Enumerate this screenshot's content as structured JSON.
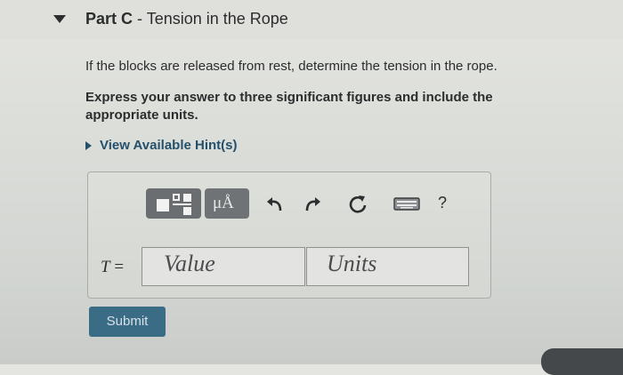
{
  "part": {
    "label": "Part C",
    "separator": " - ",
    "title": "Tension in the Rope"
  },
  "question": {
    "prompt": "If the blocks are released from rest, determine the tension in the rope.",
    "instruction": "Express your answer to three significant figures and include the appropriate units."
  },
  "hints": {
    "label": "View Available Hint(s)"
  },
  "toolbar": {
    "units_button_label": "μÅ",
    "help_label": "?",
    "icons": [
      "templates-icon",
      "units-icon",
      "undo-icon",
      "redo-icon",
      "reset-icon",
      "keyboard-icon",
      "help-icon"
    ]
  },
  "answer": {
    "variable": "T",
    "equals": " =",
    "value_placeholder": "Value",
    "units_placeholder": "Units"
  },
  "submit": {
    "label": "Submit"
  },
  "colors": {
    "submit_bg": "#3a6c86",
    "hint_link": "#24506b",
    "toolbar_button": "#6b6e70"
  }
}
